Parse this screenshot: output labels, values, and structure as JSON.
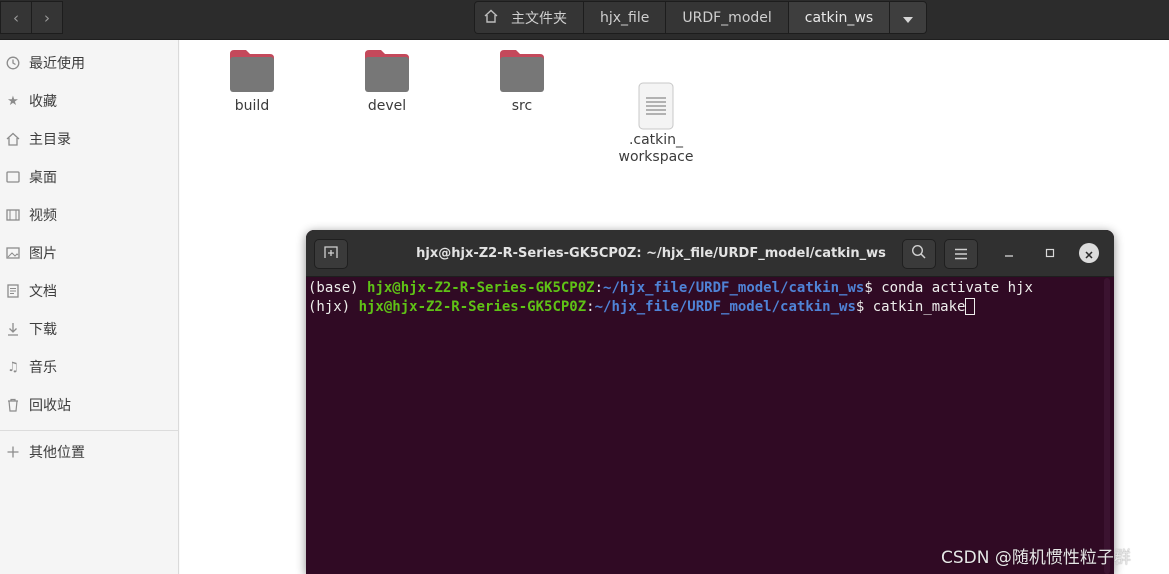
{
  "header": {
    "breadcrumbs": [
      "主文件夹",
      "hjx_file",
      "URDF_model",
      "catkin_ws"
    ]
  },
  "sidebar": {
    "items": [
      {
        "label": "最近使用",
        "icon": "clock-icon"
      },
      {
        "label": "收藏",
        "icon": "star-icon"
      },
      {
        "label": "主目录",
        "icon": "home-icon"
      },
      {
        "label": "桌面",
        "icon": "desktop-icon"
      },
      {
        "label": "视频",
        "icon": "video-icon"
      },
      {
        "label": "图片",
        "icon": "image-icon"
      },
      {
        "label": "文档",
        "icon": "document-icon"
      },
      {
        "label": "下载",
        "icon": "download-icon"
      },
      {
        "label": "音乐",
        "icon": "music-icon"
      },
      {
        "label": "回收站",
        "icon": "trash-icon"
      }
    ],
    "other_locations": "其他位置"
  },
  "files": [
    {
      "name": "build",
      "type": "folder"
    },
    {
      "name": "devel",
      "type": "folder"
    },
    {
      "name": "src",
      "type": "folder"
    },
    {
      "name": ".catkin_\nworkspace",
      "type": "file"
    }
  ],
  "terminal": {
    "title": "hjx@hjx-Z2-R-Series-GK5CP0Z: ~/hjx_file/URDF_model/catkin_ws",
    "lines": [
      {
        "env": "(base) ",
        "user": "hjx@hjx-Z2-R-Series-GK5CP0Z",
        "sep": ":",
        "path": "~/hjx_file/URDF_model/catkin_ws",
        "prompt": "$ ",
        "cmd": "conda activate hjx"
      },
      {
        "env": "(hjx) ",
        "user": "hjx@hjx-Z2-R-Series-GK5CP0Z",
        "sep": ":",
        "path": "~/hjx_file/URDF_model/catkin_ws",
        "prompt": "$ ",
        "cmd": "catkin_make"
      }
    ]
  },
  "watermark": "CSDN @随机惯性粒子群",
  "colors": {
    "terminal_bg": "#300a24",
    "prompt_user": "#5fc216",
    "prompt_path": "#4f83d6",
    "folder": "#777777",
    "folder_tab": "#c4495b"
  }
}
